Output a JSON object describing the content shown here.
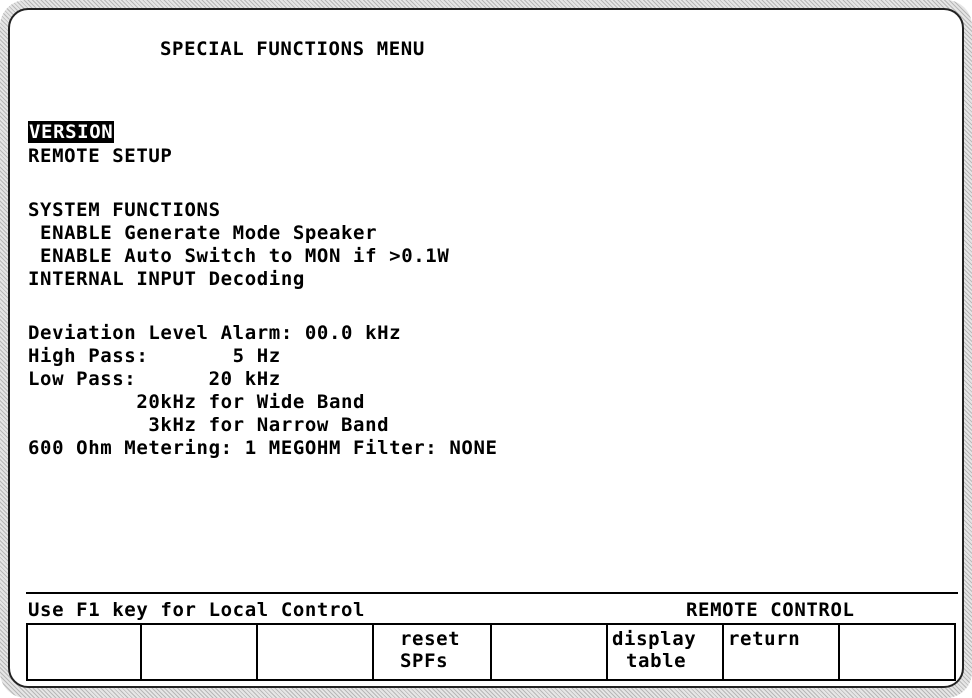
{
  "title": "SPECIAL FUNCTIONS MENU",
  "menu": {
    "version": "VERSION",
    "remote_setup": "REMOTE SETUP",
    "system_functions": "SYSTEM FUNCTIONS",
    "enable_speaker": " ENABLE Generate Mode Speaker",
    "enable_auto_switch": " ENABLE Auto Switch to MON if >0.1W",
    "internal_input": "INTERNAL INPUT Decoding",
    "deviation_alarm": "Deviation Level Alarm: 00.0 kHz",
    "high_pass": "High Pass:       5 Hz",
    "low_pass": "Low Pass:      20 kHz",
    "wide_band": "         20kHz for Wide Band",
    "narrow_band": "          3kHz for Narrow Band",
    "metering": "600 Ohm Metering: 1 MEGOHM Filter: NONE"
  },
  "status": {
    "left": "Use F1 key for Local Control",
    "right": "REMOTE CONTROL"
  },
  "softkeys": [
    {
      "line1": "",
      "line2": ""
    },
    {
      "line1": "",
      "line2": ""
    },
    {
      "line1": "",
      "line2": ""
    },
    {
      "line1": "reset",
      "line2": "SPFs"
    },
    {
      "line1": "",
      "line2": ""
    },
    {
      "line1": "display",
      "line2": "table"
    },
    {
      "line1": "return",
      "line2": ""
    },
    {
      "line1": "",
      "line2": ""
    }
  ]
}
